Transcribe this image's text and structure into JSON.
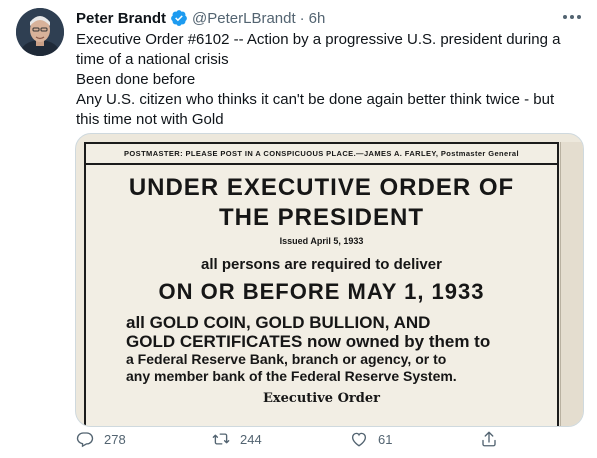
{
  "author": {
    "name": "Peter Brandt",
    "handle": "@PeterLBrandt",
    "separator": "·",
    "time": "6h"
  },
  "tweet": {
    "lines": [
      "Executive Order #6102 -- Action by a progressive U.S. president during a time of a national crisis",
      "Been done before",
      "Any U.S. citizen who thinks it can't be done again better think twice - but this time not with Gold"
    ]
  },
  "poster": {
    "postmaster": "POSTMASTER: PLEASE POST IN A CONSPICUOUS PLACE.—JAMES A. FARLEY, Postmaster General",
    "headline_1": "UNDER EXECUTIVE ORDER OF",
    "headline_2": "THE PRESIDENT",
    "issued": "Issued April 5, 1933",
    "persons": "all persons are required to deliver",
    "deadline": "ON OR BEFORE MAY 1, 1933",
    "gold_1": "all GOLD COIN, GOLD BULLION, AND",
    "gold_2": "GOLD CERTIFICATES now owned by them to",
    "fed_1": "a Federal Reserve Bank, branch or agency, or to",
    "fed_2": "any member bank of the Federal Reserve System.",
    "signature": "Executive Order"
  },
  "actions": {
    "replies": "278",
    "retweets": "244",
    "likes": "61"
  },
  "icons": [
    "verified-badge-icon",
    "more-options-icon",
    "reply-icon",
    "retweet-icon",
    "like-icon",
    "share-icon"
  ],
  "colors": {
    "text_primary": "#0f1419",
    "text_secondary": "#536471",
    "verified": "#1d9bf0",
    "border": "#cfd9de"
  }
}
